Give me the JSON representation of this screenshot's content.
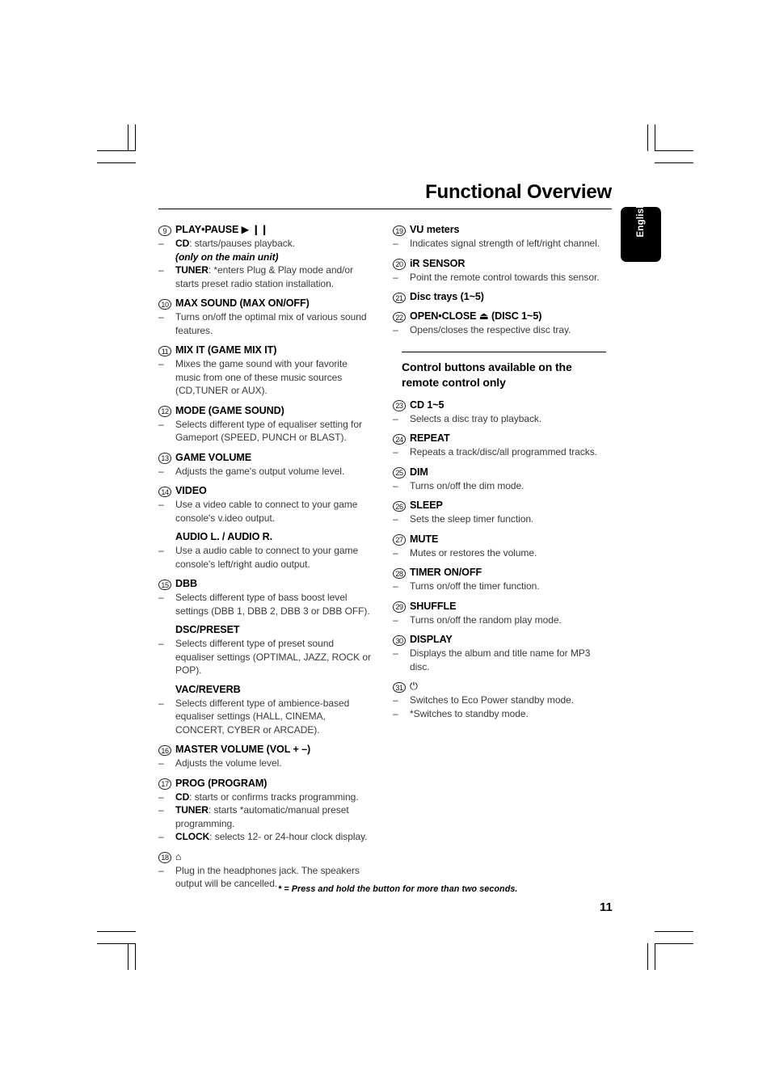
{
  "page": {
    "title": "Functional Overview",
    "language_tab": "English",
    "footnote": "* = Press and hold the button for more than two seconds.",
    "page_number": "11"
  },
  "left_column": [
    {
      "number": "9",
      "label": "PLAY•PAUSE",
      "symbol": "▶ ❙❙",
      "lines": [
        {
          "dash": "–",
          "bold": "CD",
          "text": ": starts/pauses playback."
        },
        {
          "dash": "",
          "italic": "(only on the main unit)",
          "text": ""
        },
        {
          "dash": "–",
          "bold": "TUNER",
          "text": ": *enters Plug & Play mode and/or starts preset radio station installation."
        }
      ]
    },
    {
      "number": "10",
      "label": "MAX SOUND (MAX ON/OFF)",
      "symbol": "",
      "lines": [
        {
          "dash": "–",
          "text": "Turns on/off the optimal mix of various sound features."
        }
      ]
    },
    {
      "number": "11",
      "label": "MIX IT (GAME MIX IT)",
      "symbol": "",
      "lines": [
        {
          "dash": "–",
          "text": "Mixes the game sound with your favorite music from one of these music sources (CD,TUNER or AUX)."
        }
      ]
    },
    {
      "number": "12",
      "label": "MODE (GAME SOUND)",
      "symbol": "",
      "lines": [
        {
          "dash": "–",
          "text": "Selects different type of equaliser setting for Gameport (SPEED, PUNCH or BLAST)."
        }
      ]
    },
    {
      "number": "13",
      "label": "GAME VOLUME",
      "symbol": "",
      "lines": [
        {
          "dash": "–",
          "text": "Adjusts the game's output volume level."
        }
      ]
    },
    {
      "number": "14",
      "label": "VIDEO",
      "symbol": "",
      "lines": [
        {
          "dash": "–",
          "text": "Use a video cable to connect to your game console's v.ideo output."
        }
      ],
      "subsections": [
        {
          "label": "AUDIO L. / AUDIO R.",
          "lines": [
            {
              "dash": "–",
              "text": "Use a audio cable to connect to your game console's left/right audio output."
            }
          ]
        }
      ]
    },
    {
      "number": "15",
      "label": "DBB",
      "symbol": "",
      "lines": [
        {
          "dash": "–",
          "text": "Selects different type of bass boost level settings (DBB 1, DBB 2, DBB 3 or DBB OFF)."
        }
      ],
      "subsections": [
        {
          "label": "DSC/PRESET",
          "lines": [
            {
              "dash": "–",
              "text": "Selects different type of preset sound equaliser settings (OPTIMAL, JAZZ, ROCK or POP)."
            }
          ]
        },
        {
          "label": "VAC/REVERB",
          "lines": [
            {
              "dash": "–",
              "text": "Selects different type of ambience-based equaliser settings (HALL, CINEMA, CONCERT, CYBER or ARCADE)."
            }
          ]
        }
      ]
    },
    {
      "number": "16",
      "label": "MASTER VOLUME (VOL + –)",
      "symbol": "",
      "lines": [
        {
          "dash": "–",
          "text": "Adjusts the volume level."
        }
      ]
    },
    {
      "number": "17",
      "label": "PROG (PROGRAM)",
      "symbol": "",
      "lines": [
        {
          "dash": "–",
          "bold": "CD",
          "text": ": starts or confirms tracks programming."
        },
        {
          "dash": "–",
          "bold": "TUNER",
          "text": ": starts *automatic/manual preset programming."
        },
        {
          "dash": "–",
          "bold": "CLOCK",
          "text": ": selects 12- or 24-hour clock display."
        }
      ]
    },
    {
      "number": "18",
      "label": "",
      "icon": "headphones-icon",
      "symbol": "⌂",
      "lines": [
        {
          "dash": "–",
          "text": "Plug in the headphones jack. The speakers output will be cancelled."
        }
      ]
    }
  ],
  "right_column_top": [
    {
      "number": "19",
      "label": "VU meters",
      "symbol": "",
      "lines": [
        {
          "dash": "–",
          "text": "Indicates signal strength of left/right channel."
        }
      ]
    },
    {
      "number": "20",
      "label": "iR SENSOR",
      "symbol": "",
      "lines": [
        {
          "dash": "–",
          "text": "Point the remote control towards this sensor."
        }
      ]
    },
    {
      "number": "21",
      "label": "Disc trays (1~5)",
      "symbol": "",
      "lines": []
    },
    {
      "number": "22",
      "label": "OPEN•CLOSE",
      "symbol": "⏏",
      "label_after": "(DISC 1~5)",
      "lines": [
        {
          "dash": "–",
          "text": "Opens/closes the respective disc tray."
        }
      ]
    }
  ],
  "right_section": {
    "heading": "Control buttons available on the remote control only",
    "items": [
      {
        "number": "23",
        "label": "CD 1~5",
        "symbol": "",
        "lines": [
          {
            "dash": "–",
            "text": "Selects a disc tray to playback."
          }
        ]
      },
      {
        "number": "24",
        "label": "REPEAT",
        "symbol": "",
        "lines": [
          {
            "dash": "–",
            "text": "Repeats a track/disc/all programmed tracks."
          }
        ]
      },
      {
        "number": "25",
        "label": "DIM",
        "symbol": "",
        "lines": [
          {
            "dash": "–",
            "text": "Turns on/off the dim mode."
          }
        ]
      },
      {
        "number": "26",
        "label": "SLEEP",
        "symbol": "",
        "lines": [
          {
            "dash": "–",
            "text": "Sets the sleep timer function."
          }
        ]
      },
      {
        "number": "27",
        "label": "MUTE",
        "symbol": "",
        "lines": [
          {
            "dash": "–",
            "text": "Mutes or restores the volume."
          }
        ]
      },
      {
        "number": "28",
        "label": "TIMER ON/OFF",
        "symbol": "",
        "lines": [
          {
            "dash": "–",
            "text": "Turns on/off the timer function."
          }
        ]
      },
      {
        "number": "29",
        "label": "SHUFFLE",
        "symbol": "",
        "lines": [
          {
            "dash": "–",
            "text": "Turns on/off the random play mode."
          }
        ]
      },
      {
        "number": "30",
        "label": "DISPLAY",
        "symbol": "",
        "lines": [
          {
            "dash": "–",
            "text": "Displays the album and title name for MP3 disc."
          }
        ]
      },
      {
        "number": "31",
        "label": "",
        "icon": "power-standby-icon",
        "symbol": "⏻",
        "lines": [
          {
            "dash": "–",
            "text": "Switches to Eco Power standby mode."
          },
          {
            "dash": "–",
            "text": "*Switches to standby mode."
          }
        ]
      }
    ]
  }
}
